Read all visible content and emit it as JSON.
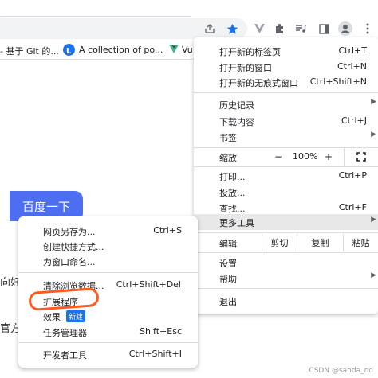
{
  "bookmarks": [
    {
      "label": "- 基于 Git 的..."
    },
    {
      "label": "A collection of po..."
    },
    {
      "label": "Vu"
    }
  ],
  "page": {
    "baidu_button": "百度一下",
    "edge_text_1": "向好",
    "edge_text_2": "官方"
  },
  "menu": {
    "new_tab": {
      "label": "打开新的标签页",
      "shortcut": "Ctrl+T"
    },
    "new_window": {
      "label": "打开新的窗口",
      "shortcut": "Ctrl+N"
    },
    "incognito": {
      "label": "打开新的无痕式窗口",
      "shortcut": "Ctrl+Shift+N"
    },
    "history": {
      "label": "历史记录"
    },
    "downloads": {
      "label": "下载内容",
      "shortcut": "Ctrl+J"
    },
    "bookmarks": {
      "label": "书签"
    },
    "zoom": {
      "label": "缩放",
      "minus": "−",
      "value": "100%",
      "plus": "+"
    },
    "print": {
      "label": "打印...",
      "shortcut": "Ctrl+P"
    },
    "cast": {
      "label": "投放..."
    },
    "find": {
      "label": "查找...",
      "shortcut": "Ctrl+F"
    },
    "more_tools": {
      "label": "更多工具"
    },
    "edit": {
      "label": "编辑",
      "cut": "剪切",
      "copy": "复制",
      "paste": "粘贴"
    },
    "settings": {
      "label": "设置"
    },
    "help": {
      "label": "帮助"
    },
    "exit": {
      "label": "退出"
    }
  },
  "submenu": {
    "save_page": {
      "label": "网页另存为...",
      "shortcut": "Ctrl+S"
    },
    "create_shortcut": {
      "label": "创建快捷方式..."
    },
    "name_window": {
      "label": "为窗口命名..."
    },
    "clear_data": {
      "label": "清除浏览数据...",
      "shortcut": "Ctrl+Shift+Del"
    },
    "extensions": {
      "label": "扩展程序"
    },
    "effects": {
      "label": "效果",
      "badge": "新建"
    },
    "task_manager": {
      "label": "任务管理器",
      "shortcut": "Shift+Esc"
    },
    "devtools": {
      "label": "开发者工具",
      "shortcut": "Ctrl+Shift+I"
    }
  },
  "watermark": "CSDN @sanda_nd",
  "colors": {
    "accent": "#1a73e8",
    "baidu_blue": "#4e6ef2",
    "annotation": "#ff5a1f"
  }
}
